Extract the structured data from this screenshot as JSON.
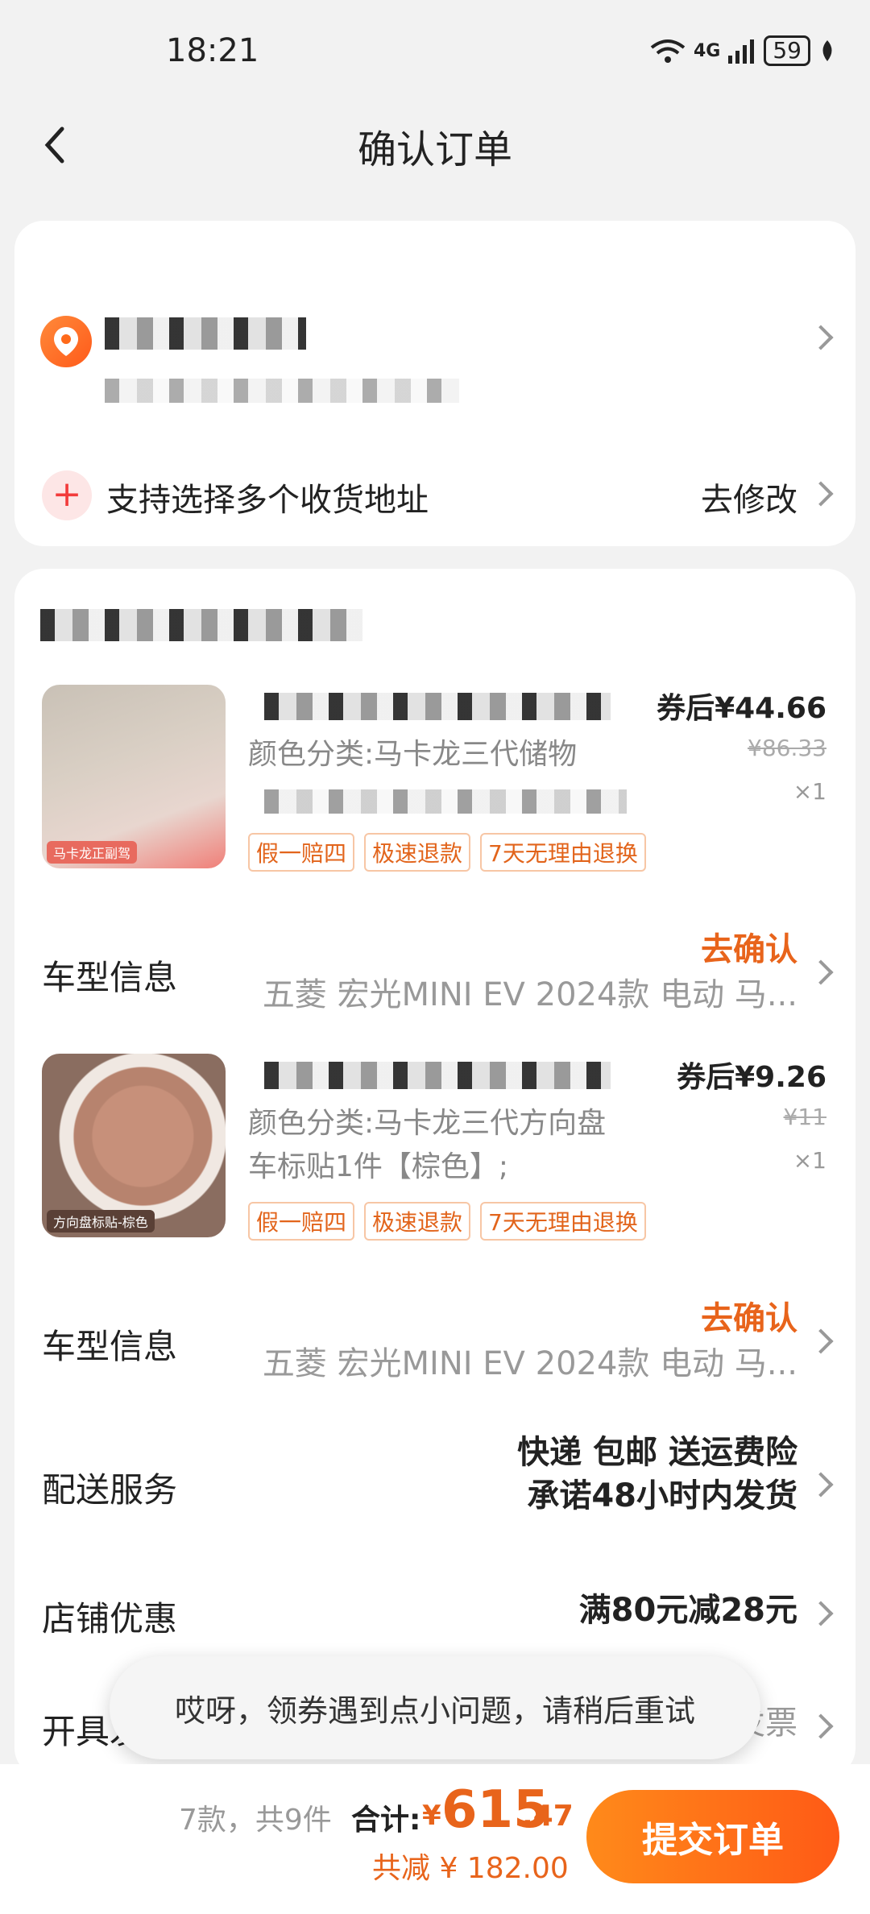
{
  "status_bar": {
    "time": "18:21",
    "network": "4G",
    "battery": "59"
  },
  "header": {
    "title": "确认订单"
  },
  "address": {
    "multi_tip": "支持选择多个收货地址",
    "modify": "去修改"
  },
  "products": [
    {
      "price": "券后¥44.66",
      "original_price": "¥86.33",
      "quantity": "×1",
      "spec": "颜色分类:马卡龙三代储物",
      "thumb_tag": "马卡龙正副驾",
      "badges": [
        "假一赔四",
        "极速退款",
        "7天无理由退换"
      ]
    },
    {
      "price": "券后¥9.26",
      "original_price": "¥11",
      "quantity": "×1",
      "spec": "颜色分类:马卡龙三代方向盘车标贴1件【棕色】;",
      "thumb_tag": "方向盘标贴-棕色",
      "badges": [
        "假一赔四",
        "极速退款",
        "7天无理由退换"
      ]
    }
  ],
  "vehicle_rows": [
    {
      "label": "车型信息",
      "action": "去确认",
      "value": "五菱 宏光MINI EV 2024款 电动 马..."
    },
    {
      "label": "车型信息",
      "action": "去确认",
      "value": "五菱 宏光MINI EV 2024款 电动 马..."
    }
  ],
  "delivery": {
    "label": "配送服务",
    "line1": "快递 包邮 送运费险",
    "line2": "承诺48小时内发货"
  },
  "store_discount": {
    "label": "店铺优惠",
    "value": "满80元减28元"
  },
  "invoice": {
    "label": "开具发票",
    "value": "发票"
  },
  "toast": "哎呀，领券遇到点小问题，请稍后重试",
  "footer": {
    "count": "7款，共9件",
    "total_label": "合计:",
    "currency": "¥",
    "total_int": "615",
    "total_dec": ".47",
    "saved": "共减 ¥ 182.00",
    "submit": "提交订单"
  },
  "colors": {
    "accent": "#e8641b",
    "button": "#ff6a16"
  }
}
